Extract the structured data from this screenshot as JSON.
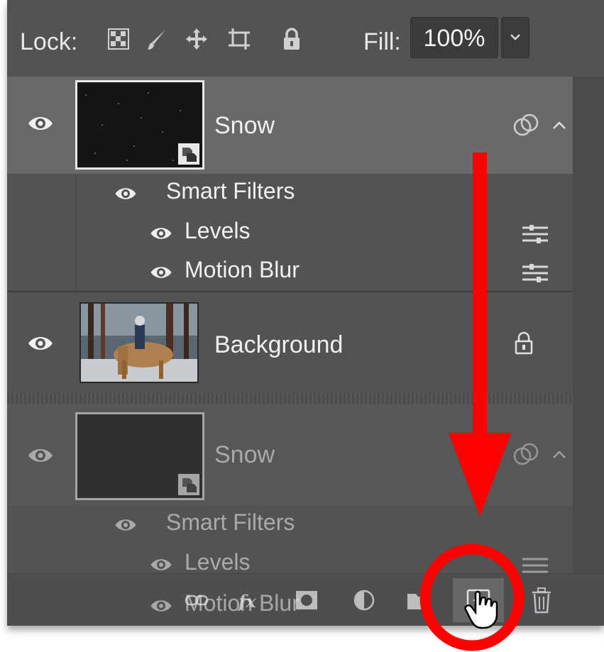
{
  "lock_bar": {
    "lock_label": "Lock:",
    "fill_label": "Fill:",
    "fill_value": "100%"
  },
  "layers": [
    {
      "name": "Snow",
      "type": "smart-object",
      "selected": true,
      "smart_filters_label": "Smart Filters",
      "filters": [
        "Levels",
        "Motion Blur"
      ]
    },
    {
      "name": "Background",
      "type": "image",
      "locked": true
    },
    {
      "name": "Snow",
      "type": "smart-object-ghost",
      "smart_filters_label": "Smart Filters",
      "filters": [
        "Levels",
        "Motion Blur"
      ]
    }
  ],
  "bottom_icons": [
    "link-layers-icon",
    "fx-icon",
    "layer-mask-icon",
    "adjustment-layer-icon",
    "new-group-icon",
    "new-layer-icon",
    "trash-icon"
  ],
  "annotation_color": "#ff0000"
}
